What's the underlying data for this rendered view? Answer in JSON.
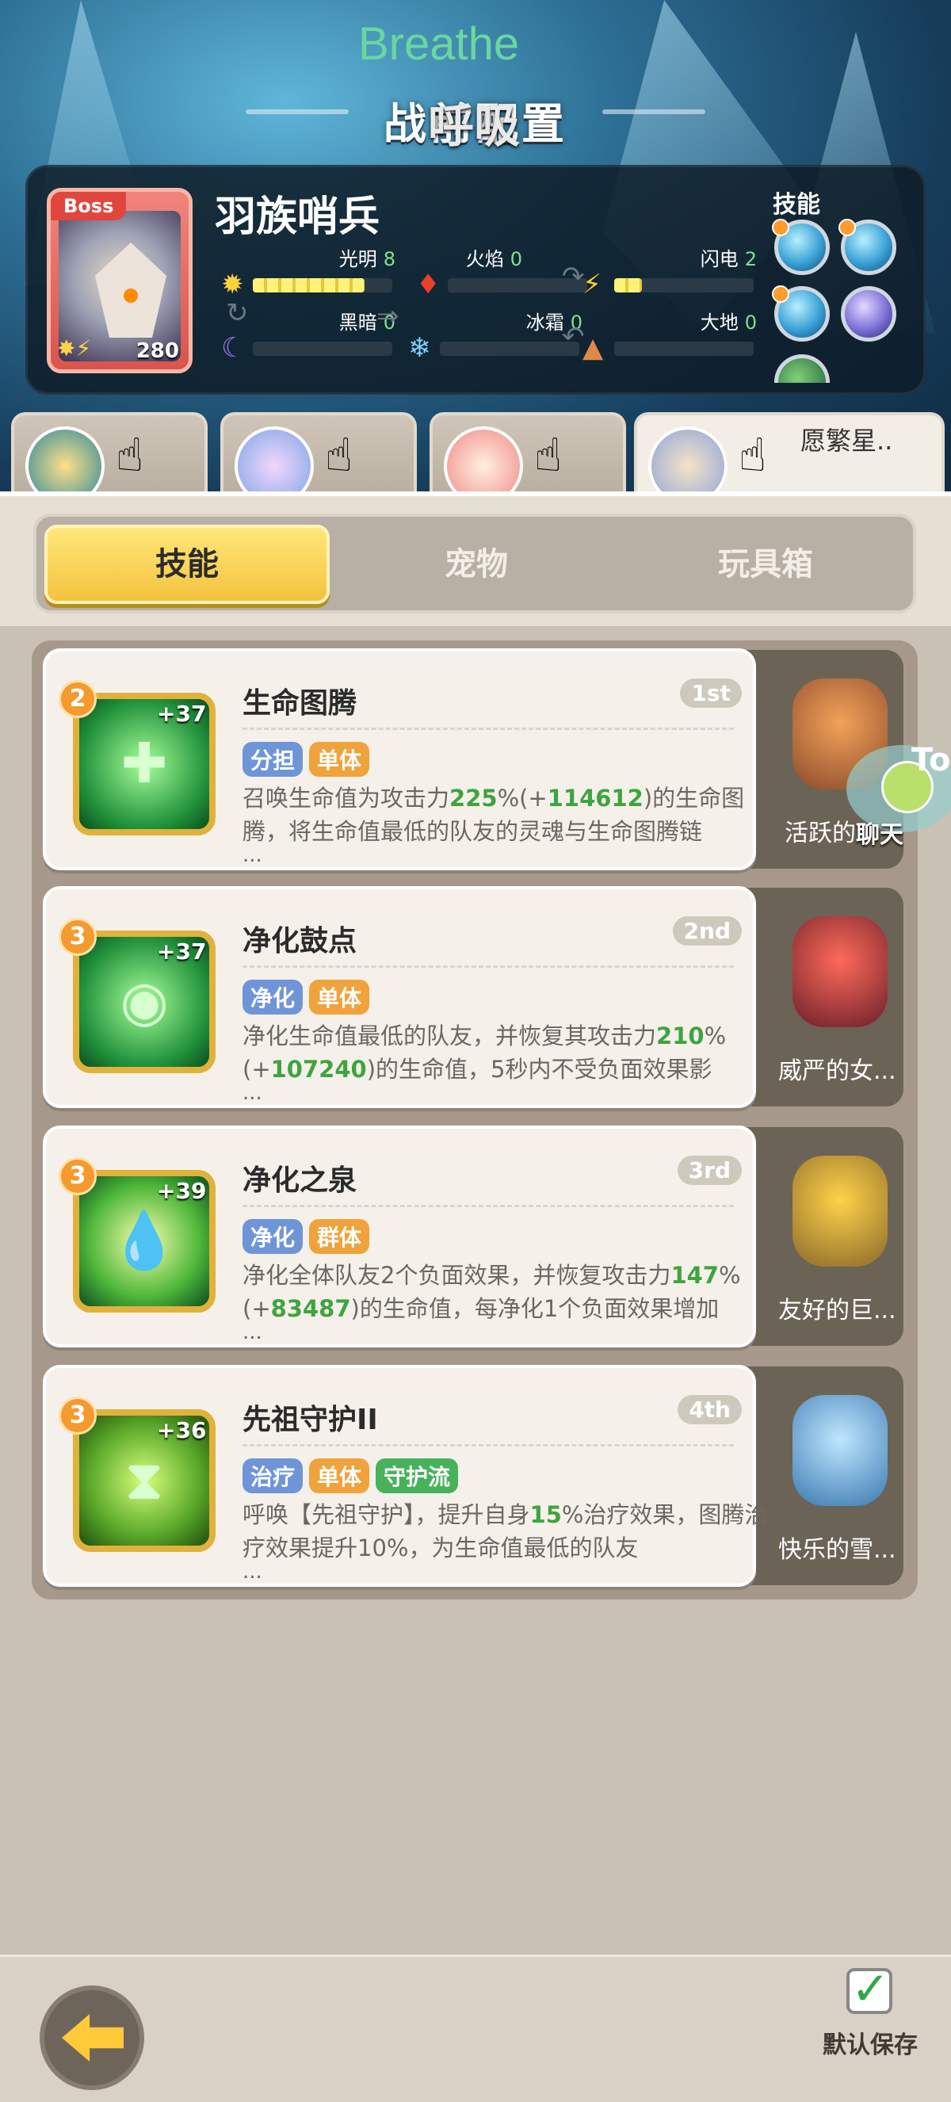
{
  "header": {
    "title": "战前配置",
    "overlay_text_en": "Breathe",
    "overlay_text_cn": "呼吸"
  },
  "boss": {
    "tag": "Boss",
    "name": "羽族哨兵",
    "power": "280",
    "elements": [
      {
        "label": "光明",
        "value": "8",
        "icon": "sun-icon"
      },
      {
        "label": "火焰",
        "value": "0",
        "icon": "fire-icon"
      },
      {
        "label": "闪电",
        "value": "2",
        "icon": "lightning-icon"
      },
      {
        "label": "黑暗",
        "value": "0",
        "icon": "moon-icon"
      },
      {
        "label": "冰霜",
        "value": "0",
        "icon": "snowflake-icon"
      },
      {
        "label": "大地",
        "value": "0",
        "icon": "mountain-icon"
      }
    ],
    "skills_label": "技能"
  },
  "team": {
    "slot4_name": "愿繁星.."
  },
  "tabs": [
    {
      "label": "技能",
      "selected": true
    },
    {
      "label": "宠物",
      "selected": false
    },
    {
      "label": "玩具箱",
      "selected": false
    }
  ],
  "skills": [
    {
      "name": "生命图腾",
      "level": "2",
      "bonus": "+37",
      "rank": "1st",
      "tags": [
        {
          "text": "分担",
          "color": "blue"
        },
        {
          "text": "单体",
          "color": "orange"
        }
      ],
      "desc_pre": "召唤生命值为攻击力",
      "desc_hl1": "225",
      "desc_mid": "%(+",
      "desc_hl2": "114612",
      "desc_post": ")的生命图腾，将生命值最低的队友的灵魂与生命图腾链",
      "pet": "活跃的"
    },
    {
      "name": "净化鼓点",
      "level": "3",
      "bonus": "+37",
      "rank": "2nd",
      "tags": [
        {
          "text": "净化",
          "color": "blue"
        },
        {
          "text": "单体",
          "color": "orange"
        }
      ],
      "desc_pre": "净化生命值最低的队友，并恢复其攻击力",
      "desc_hl1": "210",
      "desc_mid": "%(+",
      "desc_hl2": "107240",
      "desc_post": ")的生命值，5秒内不受负面效果影",
      "pet": "威严的女..."
    },
    {
      "name": "净化之泉",
      "level": "3",
      "bonus": "+39",
      "rank": "3rd",
      "tags": [
        {
          "text": "净化",
          "color": "blue"
        },
        {
          "text": "群体",
          "color": "orange"
        }
      ],
      "desc_pre": "净化全体队友2个负面效果，并恢复攻击力",
      "desc_hl1": "147",
      "desc_mid": "%(+",
      "desc_hl2": "83487",
      "desc_post": ")的生命值，每净化1个负面效果增加",
      "pet": "友好的巨..."
    },
    {
      "name": "先祖守护II",
      "level": "3",
      "bonus": "+36",
      "rank": "4th",
      "tags": [
        {
          "text": "治疗",
          "color": "blue"
        },
        {
          "text": "单体",
          "color": "orange"
        },
        {
          "text": "守护流",
          "color": "green"
        }
      ],
      "desc_pre": "呼唤【先祖守护】，提升自身",
      "desc_hl1": "15",
      "desc_mid": "",
      "desc_hl2": "",
      "desc_post": "%治疗效果，图腾治疗效果提升10%，为生命值最低的队友",
      "pet": "快乐的雪..."
    }
  ],
  "chat": {
    "label": "聊天",
    "edge": "To"
  },
  "footer": {
    "save_label": "默认保存"
  },
  "ellipsis": "..."
}
